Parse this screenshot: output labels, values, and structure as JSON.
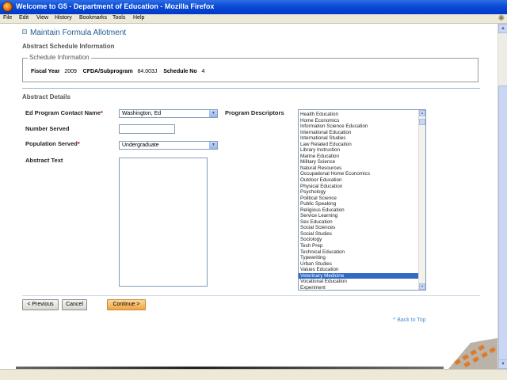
{
  "window": {
    "title": "Welcome to G5 - Department of Education - Mozilla Firefox"
  },
  "menu": [
    "File",
    "Edit",
    "View",
    "History",
    "Bookmarks",
    "Tools",
    "Help"
  ],
  "page": {
    "title": "Maintain Formula Allotment",
    "section1": "Abstract Schedule Information",
    "schedule": {
      "legend": "Schedule Information",
      "fiscal_year_label": "Fiscal Year",
      "fiscal_year": "2009",
      "cfda_label": "CFDA/Subprogram",
      "cfda": "84.003J",
      "schedule_no_label": "Schedule No",
      "schedule_no": "4"
    },
    "section2": "Abstract Details",
    "form": {
      "contact_label": "Ed Program Contact Name",
      "contact_value": "Washington, Ed",
      "number_served_label": "Number Served",
      "number_served_value": "",
      "population_label": "Population Served",
      "population_value": "Undergraduate",
      "abstract_label": "Abstract Text",
      "abstract_value": "",
      "descriptors_label": "Program Descriptors",
      "required_mark": "*"
    },
    "descriptors": [
      "Health Education",
      "Home Economics",
      "Information Science Education",
      "International Education",
      "International Studies",
      "Law Related Education",
      "Library Instruction",
      "Marine Education",
      "Military Science",
      "Natural Resources",
      "Occupational Home Economics",
      "Outdoor Education",
      "Physical Education",
      "Psychology",
      "Political Science",
      "Public Speaking",
      "Religious Education",
      "Service Learning",
      "Sex Education",
      "Social Sciences",
      "Social Studies",
      "Sociology",
      "Tech Prep",
      "Technical Education",
      "Typewriting",
      "Urban Studies",
      "Values Education",
      "Veterinary Medicine",
      "Vocational Education",
      "Experiment"
    ],
    "selected_descriptor": "Veterinary Medicine",
    "buttons": {
      "previous": "< Previous",
      "cancel": "Cancel",
      "continue": "Continue >"
    },
    "back_to_top": "^ Back to Top"
  }
}
